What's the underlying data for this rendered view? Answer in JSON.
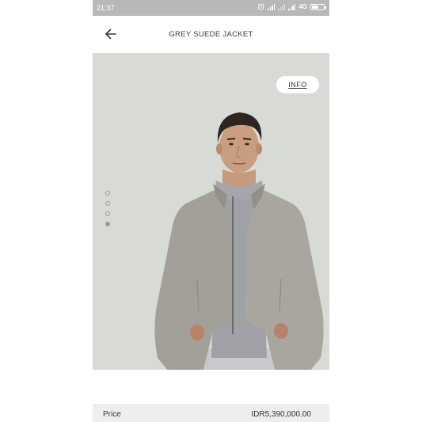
{
  "status_bar": {
    "time": "21:37",
    "network": "4G"
  },
  "header": {
    "title": "GREY SUEDE JACKET",
    "back_icon": "arrow-left-icon"
  },
  "hero": {
    "info_label": "INFO",
    "image_subject": "model-wearing-grey-suede-jacket",
    "pagination": {
      "total": 4,
      "active_index": 3
    }
  },
  "price": {
    "label": "Price",
    "value": "IDR5,390,000.00"
  },
  "colors": {
    "status_bar": "#b8b8b8",
    "hero_background": "#d8dad6",
    "jacket": "#a39f99",
    "price_row": "#eeeeee"
  }
}
